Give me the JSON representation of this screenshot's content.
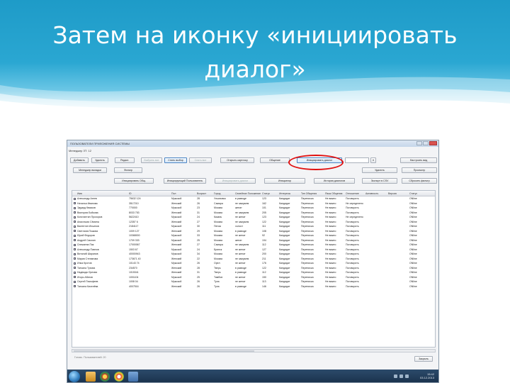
{
  "slide": {
    "title_line1": "Затем на иконку «инициировать",
    "title_line2": "диалог»"
  },
  "colors": {
    "header_blue": "#2aa7d2",
    "highlight_red": "#e01010",
    "taskbar": "#1e3652"
  },
  "window": {
    "title": "ПОЛЬЗОВАТЕЛИ ПРИЛОЖЕНИЯ СИСТЕМЫ",
    "menubar": "Менеджер ЗТ: 12",
    "toolbar1": [
      "Добавить",
      "Удалить",
      "Редакт.",
      "Выбрать все",
      "Снять выбор",
      "Снять все",
      "Открыть карточку",
      "Общение",
      "Инициировать диалог",
      "Настроить вид"
    ],
    "toolbar2": [
      "Менеджер вкладки",
      "Фильтр",
      "Удалить",
      "Просмотр",
      "Выбрать"
    ],
    "toolbar3": [
      "Инициировать Общ.",
      "Инициирующий Пользователь",
      "Инициировать диалог",
      "Инициатор",
      "История диалогов",
      "Экспорт в CSV",
      "Сбросить фильтр"
    ],
    "highlighted_button": "Инициировать диалог",
    "columns": [
      "Имя",
      "ID",
      "Пол",
      "Возраст",
      "Город",
      "Семейное Положение",
      "Статус",
      "Интересы",
      "Тип Общения",
      "Язык Общения",
      "Отношение",
      "Активность",
      "Версия",
      "Статус"
    ],
    "rows": [
      [
        "Александр Агеев",
        "75632 124",
        "Мужской",
        "28",
        "Ульяновск",
        "в разводе",
        "123",
        "Кандидат",
        "Переписка",
        "Не важно",
        "Поговорить",
        "ONline"
      ],
      [
        "Наталья Иванова",
        "3517210",
        "Женский",
        "26",
        "Самара",
        "не замужем",
        "162",
        "Кандидат",
        "Переписка",
        "Не важно",
        "Не определено",
        "ONline"
      ],
      [
        "Эдуард Квасков",
        "770000",
        "Мужской",
        "23",
        "Москва",
        "женат",
        "101",
        "Кандидат",
        "Переписка",
        "Не важно",
        "Поговорить",
        "ONline"
      ],
      [
        "Виктория Бойкова",
        "8033 753",
        "Женский",
        "31",
        "Москва",
        "не замужем",
        "205",
        "Кандидат",
        "Переписка",
        "Не важно",
        "Поговорить",
        "ONline"
      ],
      [
        "Константин Прохоров",
        "5622410",
        "Мужской",
        "24",
        "Казань",
        "не женат",
        "123",
        "Кандидат",
        "Переписка",
        "Не важно",
        "Не определено",
        "ONline"
      ],
      [
        "Анастасия Сёмина",
        "12357 6",
        "Женский",
        "27",
        "Москва",
        "не замужем",
        "122",
        "Кандидат",
        "Переписка",
        "Не важно",
        "Поговорить",
        "ONline"
      ],
      [
        "Валентин Ильинов",
        "2184117",
        "Мужской",
        "30",
        "Пенза",
        "холост",
        "111",
        "Кандидат",
        "Переписка",
        "Не важно",
        "Поговорить",
        "ONline"
      ],
      [
        "Светлана Пожова",
        "1009 127",
        "Женский",
        "29",
        "Москва",
        "в разводе",
        "108",
        "Кандидат",
        "Переписка",
        "Не важно",
        "Поговорить",
        "ONline"
      ],
      [
        "Юрий Федоров",
        "10368000",
        "Мужской",
        "33",
        "Москва",
        "не женат",
        "92",
        "Кандидат",
        "Переписка",
        "Не важно",
        "Поговорить",
        "ONline"
      ],
      [
        "Андрей Смолин",
        "1709 333",
        "Мужской",
        "25",
        "Москва",
        "женат",
        "194",
        "Кандидат",
        "Переписка",
        "Не важно",
        "Поговорить",
        "ONline"
      ],
      [
        "Снежанна Пак",
        "17000067",
        "Женский",
        "27",
        "Самара",
        "не замужем",
        "112",
        "Кандидат",
        "Переписка",
        "Не важно",
        "Поговорить",
        "ONline"
      ],
      [
        "Александр Павлов",
        "1503 67",
        "Мужской",
        "24",
        "Брянск",
        "не женат",
        "127",
        "Кандидат",
        "Переписка",
        "Не важно",
        "Поговорить",
        "ONline"
      ],
      [
        "Виталий Шарапов",
        "40000943",
        "Мужской",
        "34",
        "Москва",
        "не женат",
        "200",
        "Кандидат",
        "Переписка",
        "Не важно",
        "Поговорить",
        "ONline"
      ],
      [
        "Мария Степанова",
        "173671 40",
        "Женский",
        "22",
        "Москва",
        "не замужем",
        "211",
        "Кандидат",
        "Переписка",
        "Не важно",
        "Поговорить",
        "ONline"
      ],
      [
        "Илья Кротов",
        "10143 74",
        "Мужской",
        "26",
        "Орел",
        "не женат",
        "176",
        "Кандидат",
        "Переписка",
        "Не важно",
        "Поговорить",
        "ONline"
      ],
      [
        "Татьяна Тухова",
        "234570",
        "Женский",
        "28",
        "Тверь",
        "в разводе",
        "122",
        "Кандидат",
        "Переписка",
        "Не важно",
        "Поговорить",
        "ONline"
      ],
      [
        "Надежда Орлова",
        "1015341",
        "Женский",
        "31",
        "Тверь",
        "в разводе",
        "112",
        "Кандидат",
        "Переписка",
        "Не важно",
        "Поговорить",
        "ONline"
      ],
      [
        "Игорь Абатов",
        "1001104",
        "Мужской",
        "25",
        "Тамбов",
        "не женат",
        "150",
        "Кандидат",
        "Переписка",
        "Не важно",
        "Поговорить",
        "ONline"
      ],
      [
        "Сергей Тимофеев",
        "1008 04",
        "Мужской",
        "26",
        "Тула",
        "не женат",
        "113",
        "Кандидат",
        "Переписка",
        "Не важно",
        "Поговорить",
        "ONline"
      ],
      [
        "Татьяна Киселёва",
        "4007516",
        "Женский",
        "26",
        "Тула",
        "в разводе",
        "146",
        "Кандидат",
        "Переписка",
        "Не важно",
        "Поговорить",
        "ONline"
      ]
    ],
    "status_text": "Готово. Пользователей: 20",
    "ok_label": "Закрыть",
    "tray_time": "15:42",
    "tray_date": "03.12.2013"
  }
}
